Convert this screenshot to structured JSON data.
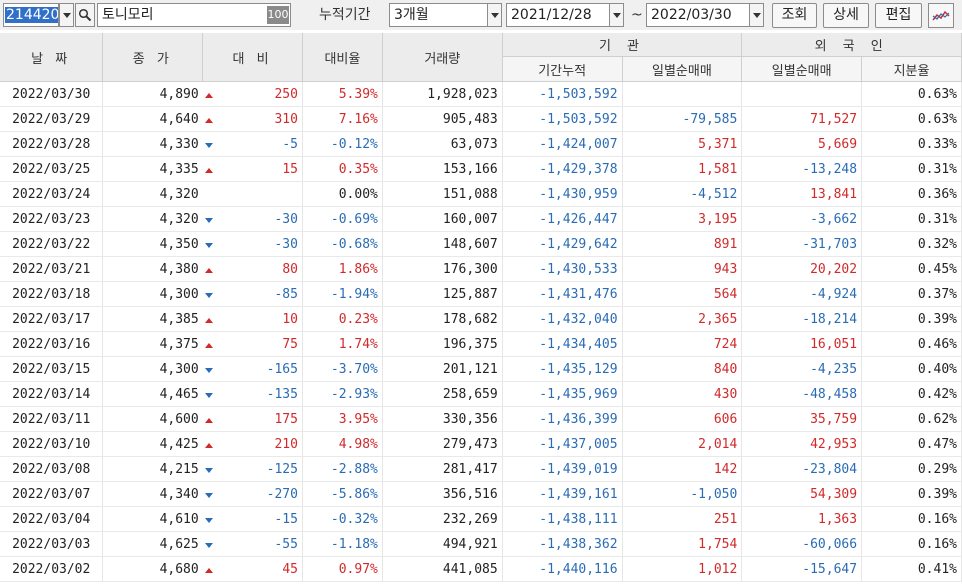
{
  "toolbar": {
    "stock_code": "214420",
    "stock_name": "토니모리",
    "name_tag": "100",
    "period_label": "누적기간",
    "period_value": "3개월",
    "start_date": "2021/12/28",
    "date_sep": "~",
    "end_date": "2022/03/30",
    "query_button": "조회",
    "detail_button": "상세",
    "edit_button": "편집",
    "search_icon": "magnifier-icon",
    "chart_icon": "line-chart-icon"
  },
  "header": {
    "date": "날 짜",
    "close": "종 가",
    "change": "대 비",
    "change_rate": "대비율",
    "volume": "거래량",
    "institution": "기 관",
    "inst_cumulative": "기간누적",
    "inst_daily": "일별순매매",
    "foreign": "외 국 인",
    "foreign_daily": "일별순매매",
    "foreign_share": "지분율"
  },
  "colors": {
    "up": "#d22a2a",
    "down": "#2a6cb4",
    "selection": "#3170c8"
  },
  "rows": [
    {
      "date": "2022/03/30",
      "close": "4,890",
      "dir": "up",
      "change": "250",
      "rate": "5.39%",
      "volume": "1,928,023",
      "inst_cum": "-1,503,592",
      "inst_daily": "",
      "frgn_daily": "",
      "share": "0.63%"
    },
    {
      "date": "2022/03/29",
      "close": "4,640",
      "dir": "up",
      "change": "310",
      "rate": "7.16%",
      "volume": "905,483",
      "inst_cum": "-1,503,592",
      "inst_daily": "-79,585",
      "frgn_daily": "71,527",
      "share": "0.63%"
    },
    {
      "date": "2022/03/28",
      "close": "4,330",
      "dir": "down",
      "change": "-5",
      "rate": "-0.12%",
      "volume": "63,073",
      "inst_cum": "-1,424,007",
      "inst_daily": "5,371",
      "frgn_daily": "5,669",
      "share": "0.33%"
    },
    {
      "date": "2022/03/25",
      "close": "4,335",
      "dir": "up",
      "change": "15",
      "rate": "0.35%",
      "volume": "153,166",
      "inst_cum": "-1,429,378",
      "inst_daily": "1,581",
      "frgn_daily": "-13,248",
      "share": "0.31%"
    },
    {
      "date": "2022/03/24",
      "close": "4,320",
      "dir": "none",
      "change": "",
      "rate": "0.00%",
      "volume": "151,088",
      "inst_cum": "-1,430,959",
      "inst_daily": "-4,512",
      "frgn_daily": "13,841",
      "share": "0.36%"
    },
    {
      "date": "2022/03/23",
      "close": "4,320",
      "dir": "down",
      "change": "-30",
      "rate": "-0.69%",
      "volume": "160,007",
      "inst_cum": "-1,426,447",
      "inst_daily": "3,195",
      "frgn_daily": "-3,662",
      "share": "0.31%"
    },
    {
      "date": "2022/03/22",
      "close": "4,350",
      "dir": "down",
      "change": "-30",
      "rate": "-0.68%",
      "volume": "148,607",
      "inst_cum": "-1,429,642",
      "inst_daily": "891",
      "frgn_daily": "-31,703",
      "share": "0.32%"
    },
    {
      "date": "2022/03/21",
      "close": "4,380",
      "dir": "up",
      "change": "80",
      "rate": "1.86%",
      "volume": "176,300",
      "inst_cum": "-1,430,533",
      "inst_daily": "943",
      "frgn_daily": "20,202",
      "share": "0.45%"
    },
    {
      "date": "2022/03/18",
      "close": "4,300",
      "dir": "down",
      "change": "-85",
      "rate": "-1.94%",
      "volume": "125,887",
      "inst_cum": "-1,431,476",
      "inst_daily": "564",
      "frgn_daily": "-4,924",
      "share": "0.37%"
    },
    {
      "date": "2022/03/17",
      "close": "4,385",
      "dir": "up",
      "change": "10",
      "rate": "0.23%",
      "volume": "178,682",
      "inst_cum": "-1,432,040",
      "inst_daily": "2,365",
      "frgn_daily": "-18,214",
      "share": "0.39%"
    },
    {
      "date": "2022/03/16",
      "close": "4,375",
      "dir": "up",
      "change": "75",
      "rate": "1.74%",
      "volume": "196,375",
      "inst_cum": "-1,434,405",
      "inst_daily": "724",
      "frgn_daily": "16,051",
      "share": "0.46%"
    },
    {
      "date": "2022/03/15",
      "close": "4,300",
      "dir": "down",
      "change": "-165",
      "rate": "-3.70%",
      "volume": "201,121",
      "inst_cum": "-1,435,129",
      "inst_daily": "840",
      "frgn_daily": "-4,235",
      "share": "0.40%"
    },
    {
      "date": "2022/03/14",
      "close": "4,465",
      "dir": "down",
      "change": "-135",
      "rate": "-2.93%",
      "volume": "258,659",
      "inst_cum": "-1,435,969",
      "inst_daily": "430",
      "frgn_daily": "-48,458",
      "share": "0.42%"
    },
    {
      "date": "2022/03/11",
      "close": "4,600",
      "dir": "up",
      "change": "175",
      "rate": "3.95%",
      "volume": "330,356",
      "inst_cum": "-1,436,399",
      "inst_daily": "606",
      "frgn_daily": "35,759",
      "share": "0.62%"
    },
    {
      "date": "2022/03/10",
      "close": "4,425",
      "dir": "up",
      "change": "210",
      "rate": "4.98%",
      "volume": "279,473",
      "inst_cum": "-1,437,005",
      "inst_daily": "2,014",
      "frgn_daily": "42,953",
      "share": "0.47%"
    },
    {
      "date": "2022/03/08",
      "close": "4,215",
      "dir": "down",
      "change": "-125",
      "rate": "-2.88%",
      "volume": "281,417",
      "inst_cum": "-1,439,019",
      "inst_daily": "142",
      "frgn_daily": "-23,804",
      "share": "0.29%"
    },
    {
      "date": "2022/03/07",
      "close": "4,340",
      "dir": "down",
      "change": "-270",
      "rate": "-5.86%",
      "volume": "356,516",
      "inst_cum": "-1,439,161",
      "inst_daily": "-1,050",
      "frgn_daily": "54,309",
      "share": "0.39%"
    },
    {
      "date": "2022/03/04",
      "close": "4,610",
      "dir": "down",
      "change": "-15",
      "rate": "-0.32%",
      "volume": "232,269",
      "inst_cum": "-1,438,111",
      "inst_daily": "251",
      "frgn_daily": "1,363",
      "share": "0.16%"
    },
    {
      "date": "2022/03/03",
      "close": "4,625",
      "dir": "down",
      "change": "-55",
      "rate": "-1.18%",
      "volume": "494,921",
      "inst_cum": "-1,438,362",
      "inst_daily": "1,754",
      "frgn_daily": "-60,066",
      "share": "0.16%"
    },
    {
      "date": "2022/03/02",
      "close": "4,680",
      "dir": "up",
      "change": "45",
      "rate": "0.97%",
      "volume": "441,085",
      "inst_cum": "-1,440,116",
      "inst_daily": "1,012",
      "frgn_daily": "-15,647",
      "share": "0.41%"
    }
  ]
}
